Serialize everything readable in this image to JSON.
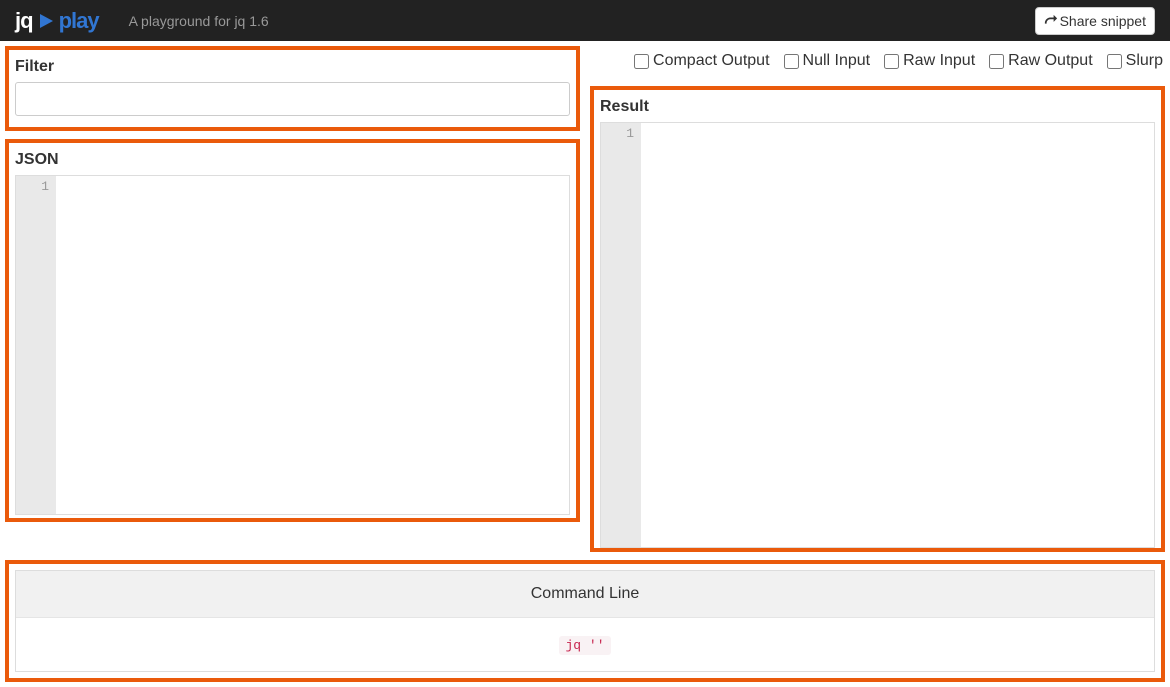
{
  "nav": {
    "brand_jq": "jq",
    "brand_play": "play",
    "tagline": "A playground for jq 1.6",
    "share_label": "Share snippet"
  },
  "options": [
    {
      "key": "compact",
      "label": "Compact Output",
      "checked": false
    },
    {
      "key": "nullinput",
      "label": "Null Input",
      "checked": false
    },
    {
      "key": "rawinput",
      "label": "Raw Input",
      "checked": false
    },
    {
      "key": "rawoutput",
      "label": "Raw Output",
      "checked": false
    },
    {
      "key": "slurp",
      "label": "Slurp",
      "checked": false
    }
  ],
  "panels": {
    "filter": {
      "title": "Filter",
      "value": ""
    },
    "json": {
      "title": "JSON",
      "gutter_line": "1",
      "content": ""
    },
    "result": {
      "title": "Result",
      "gutter_line": "1",
      "content": ""
    },
    "cli": {
      "title": "Command Line",
      "command": "jq ''"
    }
  }
}
